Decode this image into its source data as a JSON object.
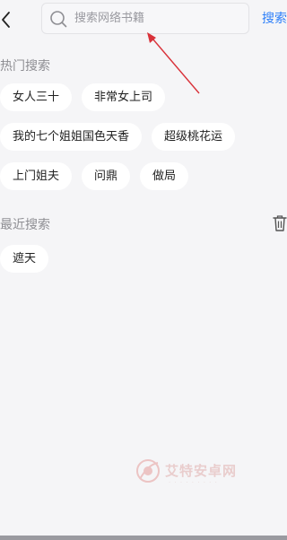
{
  "search": {
    "placeholder": "搜索网络书籍",
    "value": "",
    "action_label": "搜索"
  },
  "hot": {
    "title": "热门搜索",
    "rows": [
      [
        "女人三十",
        "非常女上司"
      ],
      [
        "我的七个姐姐国色天香",
        "超级桃花运"
      ],
      [
        "上门姐夫",
        "问鼎",
        "做局"
      ]
    ]
  },
  "recent": {
    "title": "最近搜索",
    "items": [
      "遮天"
    ]
  },
  "watermark": {
    "text": "艾特安卓网"
  },
  "icons": {
    "back": "chevron-left-icon",
    "search": "search-icon",
    "trash": "trash-icon"
  },
  "colors": {
    "background": "#f5f5f7",
    "accent": "#2d7ff9",
    "section_title": "#8e8e93",
    "annotation_arrow": "#d9323a"
  }
}
